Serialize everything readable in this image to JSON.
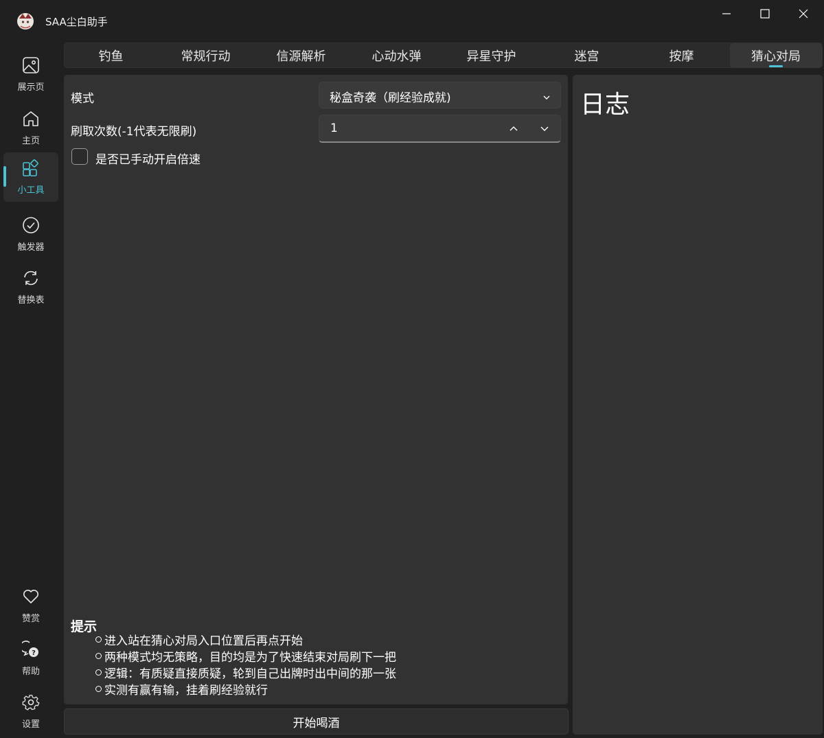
{
  "window": {
    "title": "SAA尘白助手",
    "app_icon": "app-logo-icon",
    "controls": [
      "minimize-icon",
      "maximize-icon",
      "close-icon"
    ]
  },
  "sidebar": {
    "items": [
      {
        "label": "展示页",
        "icon": "image-icon",
        "active": false
      },
      {
        "label": "主页",
        "icon": "home-icon",
        "active": false
      },
      {
        "label": "小工具",
        "icon": "apps-icon",
        "active": true
      },
      {
        "label": "触发器",
        "icon": "checkmark-circle-icon",
        "active": false
      },
      {
        "label": "替换表",
        "icon": "sync-icon",
        "active": false
      }
    ],
    "bottom_items": [
      {
        "label": "赞赏",
        "icon": "heart-icon"
      },
      {
        "label": "帮助",
        "icon": "help-chat-icon"
      },
      {
        "label": "设置",
        "icon": "gear-icon"
      }
    ]
  },
  "tabs": [
    {
      "label": "钓鱼"
    },
    {
      "label": "常规行动"
    },
    {
      "label": "信源解析"
    },
    {
      "label": "心动水弹"
    },
    {
      "label": "异星守护"
    },
    {
      "label": "迷宫"
    },
    {
      "label": "按摩"
    },
    {
      "label": "猜心对局",
      "active": true
    }
  ],
  "form": {
    "mode_label": "模式",
    "mode_value": "秘盒奇袭（刷经验成就)",
    "count_label": "刷取次数(-1代表无限刷)",
    "count_value": "1",
    "checkbox_label": "是否已手动开启倍速",
    "checkbox_checked": false
  },
  "tips": {
    "title": "提示",
    "items": [
      "进入站在猜心对局入口位置后再点开始",
      "两种模式均无策略，目的均是为了快速结束对局刷下一把",
      "逻辑：有质疑直接质疑，轮到自己出牌时出中间的那一张",
      "实测有赢有输，挂着刷经验就行"
    ]
  },
  "start_button_label": "开始喝酒",
  "log": {
    "title": "日志"
  },
  "colors": {
    "accent": "#4cc2d4",
    "background": "#202020",
    "panel": "#323232"
  }
}
